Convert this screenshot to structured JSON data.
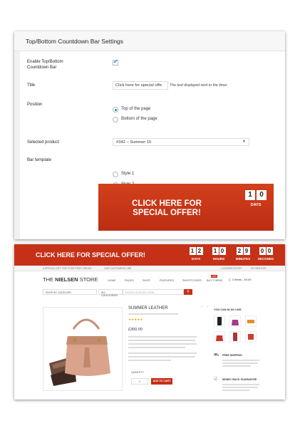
{
  "settings": {
    "header_title": "Top/Bottom Countdown Bar Settings",
    "enable_label": "Enable Top/Bottom Countdown Bar",
    "enable_checked": true,
    "title_label": "Title",
    "title_value": "Click here for special offe",
    "title_note": "The text displayed next to the timer",
    "position_label": "Position",
    "position_options": [
      "Top of the page",
      "Bottom of the page"
    ],
    "position_selected": "Top of the page",
    "product_label": "Selected product",
    "product_value": "#342 – Summer 15",
    "template_label": "Bar template",
    "template_options": [
      "Style 1",
      "Style 2"
    ],
    "template_selected": "Style 2",
    "preview": {
      "text": "CLICK HERE FOR SPECIAL OFFER!",
      "digits": [
        "1",
        "0"
      ],
      "unit": "DAYS"
    }
  },
  "store": {
    "banner_text": "CLICK HERE FOR SPECIAL OFFER!",
    "countdown": [
      {
        "digits": [
          "1",
          "2"
        ],
        "label": "DAYS"
      },
      {
        "digits": [
          "1",
          "0"
        ],
        "label": "HOURS"
      },
      {
        "digits": [
          "2",
          "9"
        ],
        "label": "MINUTES"
      },
      {
        "digits": [
          "0",
          "0"
        ],
        "label": "SECONDS"
      }
    ],
    "topbar_left": "A SPECIAL GIFT FOR YOUR FIRST ORDER",
    "topbar_mid": "OUR CUSTOMERS LINE",
    "topbar_right": "LOGIN/REGISTER",
    "topbar_account": "MY WISHLIST",
    "logo_prefix": "THE",
    "logo_name": "NIELSEN",
    "logo_suffix": "STORE",
    "nav": [
      "HOME",
      "PAGES",
      "SHOP",
      "FEATURES",
      "SHORTCODES",
      "BUY THEME"
    ],
    "hot_badge": "HOT",
    "cart": "0 items - £0.00",
    "category_select": "SHOP BY CATEGORY",
    "all_select": "ALL CATEGORIES",
    "search_placeholder": "ENTER KEYWORD HERE...",
    "product_title": "SUMMER LEATHER",
    "rating": "★★★★★",
    "price": "£300.00",
    "quantity_label": "QUANTITY",
    "quantity_value": "1",
    "add_to_cart": "ADD TO CART",
    "side_title": "YOU CAN ALSO LIKE",
    "feature_1": "FREE SHIPPING",
    "feature_2": "MONEY BACK GUARANTEE"
  },
  "colors": {
    "accent_red": "#c53117",
    "wp_blue": "#1e8cbe"
  }
}
